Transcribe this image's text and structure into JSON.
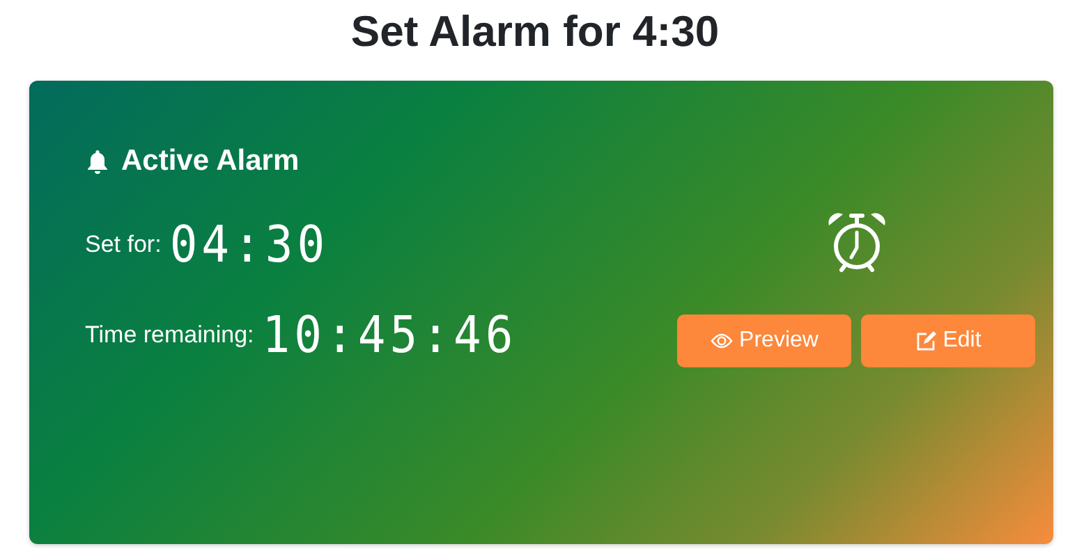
{
  "page_title": "Set Alarm for 4:30",
  "card": {
    "heading": "Active Alarm",
    "set_for": {
      "label": "Set for:",
      "value": "04:30"
    },
    "remaining": {
      "label": "Time remaining:",
      "value": "10:45:46"
    },
    "buttons": [
      {
        "label": "Preview",
        "kind": "preview"
      },
      {
        "label": "Edit",
        "kind": "edit"
      }
    ]
  }
}
